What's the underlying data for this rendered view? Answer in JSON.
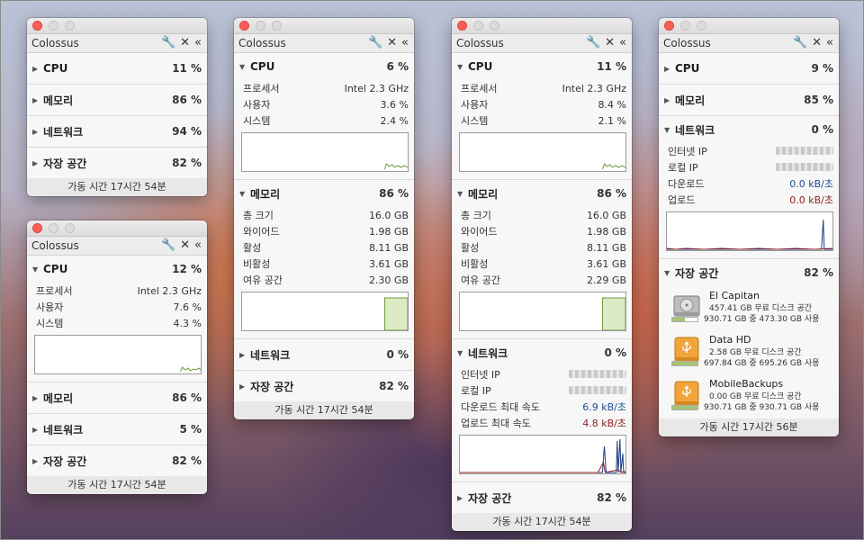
{
  "app": {
    "name": "Colossus"
  },
  "windows": [
    {
      "id": "w1",
      "sections": [
        {
          "name": "CPU",
          "value": "11 %",
          "open": false
        },
        {
          "name": "메모리",
          "value": "86 %",
          "open": false
        },
        {
          "name": "네트워크",
          "value": "94 %",
          "open": false
        },
        {
          "name": "자장 공간",
          "value": "82 %",
          "open": false
        }
      ],
      "footer": "가동 시간 17시간 54분"
    },
    {
      "id": "w2",
      "cpu": {
        "name": "CPU",
        "value": "12 %",
        "processor_label": "프로세서",
        "processor": "Intel 2.3 GHz",
        "user_label": "사용자",
        "user": "7.6 %",
        "system_label": "시스템",
        "system": "4.3 %"
      },
      "sections": [
        {
          "name": "메모리",
          "value": "86 %"
        },
        {
          "name": "네트워크",
          "value": "5 %"
        },
        {
          "name": "자장 공간",
          "value": "82 %"
        }
      ],
      "footer": "가동 시간 17시간 54분"
    },
    {
      "id": "w3",
      "cpu": {
        "name": "CPU",
        "value": "6 %",
        "processor_label": "프로세서",
        "processor": "Intel 2.3 GHz",
        "user_label": "사용자",
        "user": "3.6 %",
        "system_label": "시스템",
        "system": "2.4 %"
      },
      "memory": {
        "name": "메모리",
        "value": "86 %",
        "rows": [
          {
            "label": "총 크기",
            "value": "16.0 GB"
          },
          {
            "label": "와이어드",
            "value": "1.98 GB"
          },
          {
            "label": "활성",
            "value": "8.11 GB"
          },
          {
            "label": "비활성",
            "value": "3.61 GB"
          },
          {
            "label": "여유 공간",
            "value": "2.30 GB"
          }
        ]
      },
      "sections": [
        {
          "name": "네트워크",
          "value": "0 %"
        },
        {
          "name": "자장 공간",
          "value": "82 %"
        }
      ],
      "footer": "가동 시간 17시간 54분"
    },
    {
      "id": "w4",
      "cpu": {
        "name": "CPU",
        "value": "11 %",
        "processor_label": "프로세서",
        "processor": "Intel 2.3 GHz",
        "user_label": "사용자",
        "user": "8.4 %",
        "system_label": "시스템",
        "system": "2.1 %"
      },
      "memory": {
        "name": "메모리",
        "value": "86 %",
        "rows": [
          {
            "label": "총 크기",
            "value": "16.0 GB"
          },
          {
            "label": "와이어드",
            "value": "1.98 GB"
          },
          {
            "label": "활성",
            "value": "8.11 GB"
          },
          {
            "label": "비활성",
            "value": "3.61 GB"
          },
          {
            "label": "여유 공간",
            "value": "2.29 GB"
          }
        ]
      },
      "network": {
        "name": "네트워크",
        "value": "0 %",
        "internet_ip_label": "인터넷 IP",
        "local_ip_label": "로컬 IP",
        "download_label": "다운로드 최대 속도",
        "download": "6.9 kB/초",
        "upload_label": "업로드 최대 속도",
        "upload": "4.8 kB/초"
      },
      "storage": {
        "name": "자장 공간",
        "value": "82 %"
      },
      "footer": "가동 시간 17시간 54분"
    },
    {
      "id": "w5",
      "sections": [
        {
          "name": "CPU",
          "value": "9 %"
        },
        {
          "name": "메모리",
          "value": "85 %"
        }
      ],
      "network": {
        "name": "네트워크",
        "value": "0 %",
        "internet_ip_label": "인터넷 IP",
        "local_ip_label": "로컬 IP",
        "download_label": "다운로드",
        "download": "0.0 kB/초",
        "upload_label": "업로드",
        "upload": "0.0 kB/초"
      },
      "storage": {
        "name": "자장 공간",
        "value": "82 %",
        "disks": [
          {
            "name": "El Capitan",
            "free": "457.41 GB 무료 디스크 공간",
            "used": "930.71 GB 중 473.30 GB 사용",
            "icon": "hard-drive-icon",
            "fill": 0.51
          },
          {
            "name": "Data HD",
            "free": "2.58 GB 무료 디스크 공간",
            "used": "697.84 GB 중 695.26 GB 사용",
            "icon": "usb-drive-icon",
            "fill": 1.0
          },
          {
            "name": "MobileBackups",
            "free": "0.00 GB 무료 디스크 공간",
            "used": "930.71 GB 중 930.71 GB 사용",
            "icon": "usb-drive-icon",
            "fill": 1.0
          }
        ]
      },
      "footer": "가동 시간 17시간 56분"
    }
  ],
  "colors": {
    "close": "#fc5e57",
    "download": "#1d4f93",
    "upload": "#8c1f1f",
    "graph_green": "#6e9a3a",
    "graph_blue": "#1f3f87"
  }
}
